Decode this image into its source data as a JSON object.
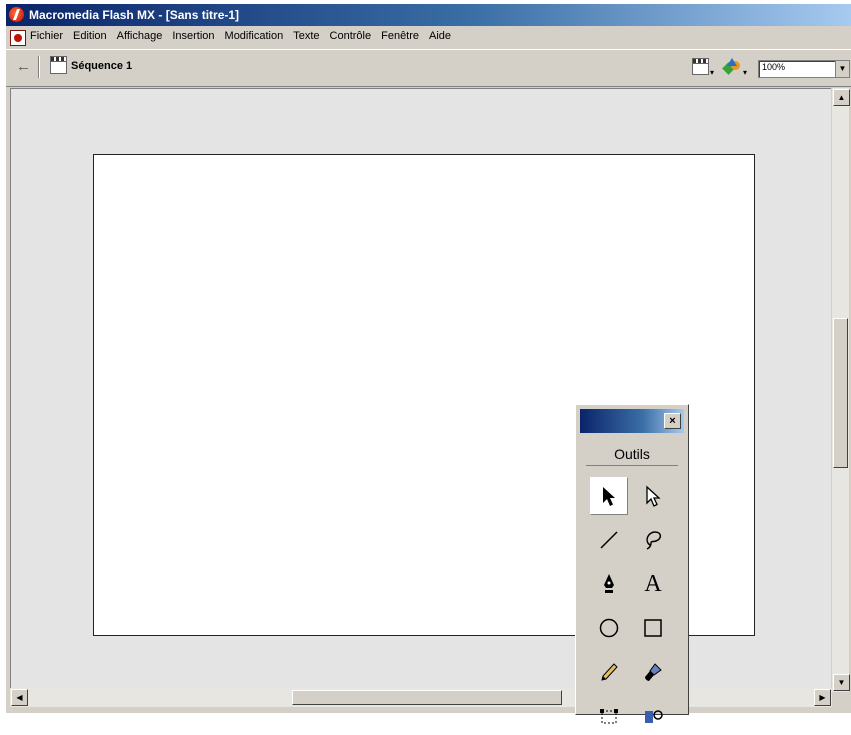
{
  "window": {
    "title": "Macromedia Flash MX - [Sans titre-1]"
  },
  "menu": {
    "items": [
      "Fichier",
      "Edition",
      "Affichage",
      "Insertion",
      "Modification",
      "Texte",
      "Contrôle",
      "Fenêtre",
      "Aide"
    ]
  },
  "editbar": {
    "scene_label": "Séquence 1",
    "zoom_value": "100%"
  },
  "tools_panel": {
    "header": "Outils",
    "selected_tool": "arrow-tool",
    "tools": [
      [
        "arrow-tool-icon",
        "subselect-tool-icon"
      ],
      [
        "line-tool-icon",
        "lasso-tool-icon"
      ],
      [
        "pen-tool-icon",
        "text-tool-icon"
      ],
      [
        "oval-tool-icon",
        "rectangle-tool-icon"
      ],
      [
        "pencil-tool-icon",
        "brush-tool-icon"
      ],
      [
        "free-transform-tool-icon",
        "fill-transform-tool-icon"
      ]
    ],
    "text_tool_glyph": "A"
  },
  "colors": {
    "title_bar": "#0a246a",
    "chrome": "#d4d0c8",
    "workspace": "#e4e4e4",
    "stage": "#ffffff"
  }
}
